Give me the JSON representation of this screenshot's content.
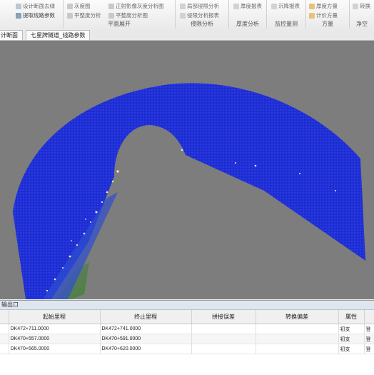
{
  "ribbon": {
    "groups": [
      {
        "caption": "",
        "items": [
          "设计断面去绿",
          "提取线路参数"
        ]
      },
      {
        "caption": "平面展开",
        "items": [
          "灰度图",
          "正射影像灰度分析图",
          "平整度分析",
          "平整度分析图"
        ]
      },
      {
        "caption": "侵限分析",
        "items": [
          "局部侵限分析",
          "侵限分析报表"
        ]
      },
      {
        "caption": "厚度分析",
        "items": [
          "厚度报表"
        ]
      },
      {
        "caption": "监控量测",
        "items": [
          "沉降报表"
        ]
      },
      {
        "caption": "方量",
        "items": [
          "厚度方量",
          "计价方量"
        ]
      },
      {
        "caption": "净空",
        "items": [
          "转换"
        ]
      }
    ]
  },
  "tabs": [
    "计断面",
    "七星牌隧道_线路参数"
  ],
  "colors": {
    "scan": "#1f2fd6",
    "viewport": "#7d7d7d"
  },
  "panel": {
    "title": "输出口",
    "columns": [
      "",
      "起始里程",
      "终止里程",
      "拼接误差",
      "转换偏差",
      "属性",
      ""
    ],
    "rows": [
      [
        "",
        "DK472+711.0000",
        "DK472+741.0000",
        "",
        "",
        "初支",
        "登"
      ],
      [
        "",
        "DK470+557.0000",
        "DK470+591.0000",
        "",
        "",
        "初支",
        "登"
      ],
      [
        "",
        "DK470+565.0000",
        "DK470+620.0000",
        "",
        "",
        "初支",
        "登"
      ]
    ]
  }
}
